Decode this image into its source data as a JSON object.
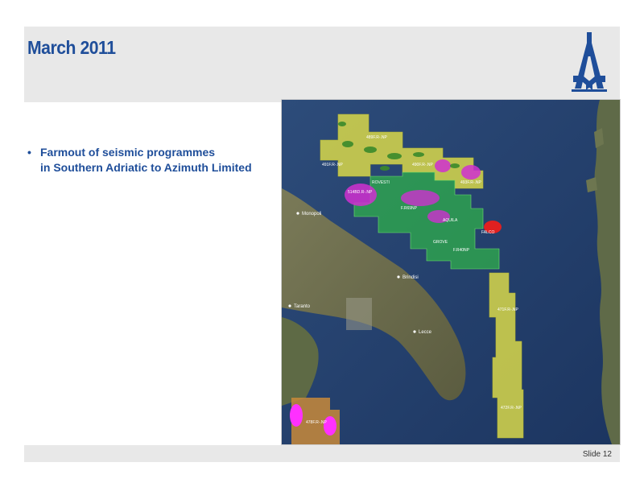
{
  "slide": {
    "title": "March 2011",
    "number_label": "Slide 12"
  },
  "bullets": [
    {
      "line1": "Farmout of seismic programmes",
      "line2": "in Southern Adriatic to Azimuth Limited"
    }
  ],
  "bullet_symbol": "•",
  "map": {
    "cities": {
      "monopoli": "Monopoli",
      "brindisi": "Brindisi",
      "taranto": "Taranto",
      "lecce": "Lecce"
    },
    "block_labels": {
      "b489": "489F.R-.NP",
      "b491": "491F.R-.NP",
      "b490": "490F.R-.NP",
      "b493": "493F.R-.NP",
      "b514": "514BD.R-.NP",
      "b5": "F.R69NP",
      "b6": "F.R40NP",
      "b471": "471F.R-.NP",
      "b472": "472F.R-.NP",
      "b478": "478F.R-.NP"
    },
    "prospects": {
      "rovesti": "ROVESTI",
      "aquila": "AQUILA",
      "falco": "FALCO",
      "grove": "GROVE"
    },
    "colors": {
      "sea": "#24406b",
      "land": "#6b6a4c",
      "permit_yellow": "#d8d84a",
      "permit_green": "#2fb34a",
      "prospect_magenta": "#d030d0",
      "prospect_red": "#e02020",
      "permit_orange": "#c88a3a"
    }
  },
  "colors": {
    "title_blue": "#1f4e9a",
    "band_gray": "#e8e8e8"
  }
}
